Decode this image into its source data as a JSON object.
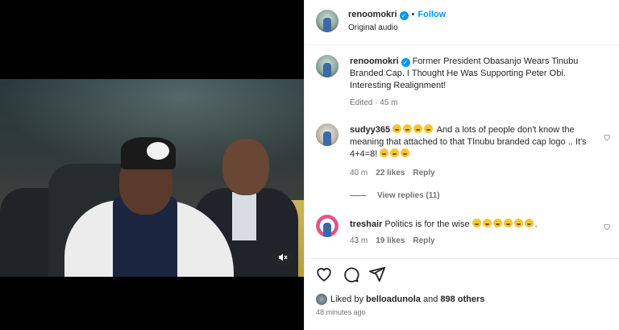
{
  "post": {
    "username": "renoomokri",
    "follow_label": "Follow",
    "audio": "Original audio",
    "caption": "Former President Obasanjo Wears Tinubu Branded Cap. I Thought He Was Supporting Peter Obi. Interesting Realignment!",
    "edited": "Edited · 45 m"
  },
  "comments": [
    {
      "username": "sudyy365",
      "text_before": "And a lots of people don't know the meaning that attached to that TInubu branded cap logo .. It's 4+4=8!",
      "time": "40 m",
      "likes": "22 likes",
      "reply": "Reply",
      "view_replies": "View replies (11)"
    },
    {
      "username": "treshair",
      "text": "Politics is for the wise",
      "trailing": ".",
      "time": "43 m",
      "likes": "19 likes",
      "reply": "Reply"
    }
  ],
  "footer": {
    "liked_prefix": "Liked by",
    "liked_user": "belloadunola",
    "liked_and": "and",
    "liked_others": "898 others",
    "time_ago": "48 minutes ago"
  },
  "icons": {
    "verified": "verified-badge-icon",
    "heart": "heart-icon",
    "comment": "comment-icon",
    "share": "share-icon",
    "mute": "muted-speaker-icon"
  },
  "colors": {
    "accent": "#0095f6",
    "muted_text": "#737373",
    "text": "#262626"
  }
}
